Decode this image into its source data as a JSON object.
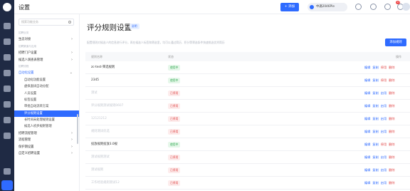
{
  "app": {
    "title": "设置"
  },
  "topbar": {
    "add_label": "+ 添加",
    "org_label": "中通2046Ple",
    "notification_count": "17"
  },
  "sidebar": {
    "search_placeholder": "搜索功能业务",
    "items": [
      {
        "label": "招聘业务",
        "kind": "group"
      },
      {
        "label": "生态对接",
        "kind": "item",
        "chevron": "›"
      },
      {
        "label": "招聘渠道与应用",
        "kind": "group"
      },
      {
        "label": "招聘门户设置",
        "kind": "item",
        "chevron": "›"
      },
      {
        "label": "候选人调查表管理",
        "kind": "item",
        "chevron": "›"
      },
      {
        "label": "招聘流程",
        "kind": "group"
      },
      {
        "label": "自动化设置",
        "kind": "open",
        "chevron": "⌄"
      },
      {
        "label": "自动化功能设置",
        "kind": "sub"
      },
      {
        "label": "虚拟面试自动分配",
        "kind": "sub"
      },
      {
        "label": "人员设置",
        "kind": "sub"
      },
      {
        "label": "标签设置",
        "kind": "sub"
      },
      {
        "label": "审批自动流转方案",
        "kind": "sub"
      },
      {
        "label": "评分规则设置",
        "kind": "selected"
      },
      {
        "label": "长时间未处理规则设置",
        "kind": "sub"
      },
      {
        "label": "候选人初步规则管理",
        "kind": "sub"
      },
      {
        "label": "招聘流程管理",
        "kind": "item",
        "chevron": "›"
      },
      {
        "label": "流程管理",
        "kind": "item",
        "chevron": "›"
      },
      {
        "label": "保护期设置",
        "kind": "item",
        "chevron": "›"
      },
      {
        "label": "自定义招聘设置",
        "kind": "item",
        "chevron": "›"
      }
    ]
  },
  "main": {
    "title": "评分规则设置",
    "tag": "说明",
    "description": "配置规则对候选人的信息进行评分，再在候选人标签和筛选里，均可以通过简历、积分等筛选条件快速挑选优秀简历",
    "add_button": "添加规则",
    "columns": {
      "name": "规则名称",
      "status": "状态",
      "ops": "操作"
    },
    "rows": [
      {
        "name": "zc-test-筛选规则",
        "faded": false,
        "status": "使用中",
        "status_kind": "on",
        "toggle": "停用"
      },
      {
        "name": "2345",
        "faded": false,
        "status": "使用中",
        "status_kind": "on",
        "toggle": "停用"
      },
      {
        "name": "测试",
        "faded": true,
        "status": "已停用",
        "status_kind": "off",
        "toggle": "启用"
      },
      {
        "name": "评分规则测试规则0607",
        "faded": true,
        "status": "已停用",
        "status_kind": "off",
        "toggle": "启用"
      },
      {
        "name": "12121212",
        "faded": true,
        "status": "已停用",
        "status_kind": "off",
        "toggle": "启用"
      },
      {
        "name": "规则测试优选",
        "faded": true,
        "status": "已停用",
        "status_kind": "off",
        "toggle": "启用"
      },
      {
        "name": "投放规则投放3.0规",
        "faded": false,
        "status": "使用中",
        "status_kind": "on",
        "toggle": "停用"
      },
      {
        "name": "测试规则测试",
        "faded": true,
        "status": "已停用",
        "status_kind": "off",
        "toggle": "启用"
      },
      {
        "name": "测试规则",
        "faded": true,
        "status": "已停用",
        "status_kind": "off",
        "toggle": "启用"
      },
      {
        "name": "工作经验规则测试12",
        "faded": true,
        "status": "已停用",
        "status_kind": "off",
        "toggle": "启用"
      }
    ],
    "op_labels": {
      "edit": "编辑",
      "copy": "复制",
      "delete": "删除"
    }
  },
  "colors": {
    "accent": "#2f6bff",
    "danger": "#e04848",
    "success": "#2fa84f",
    "rail": "#1f2a44"
  }
}
